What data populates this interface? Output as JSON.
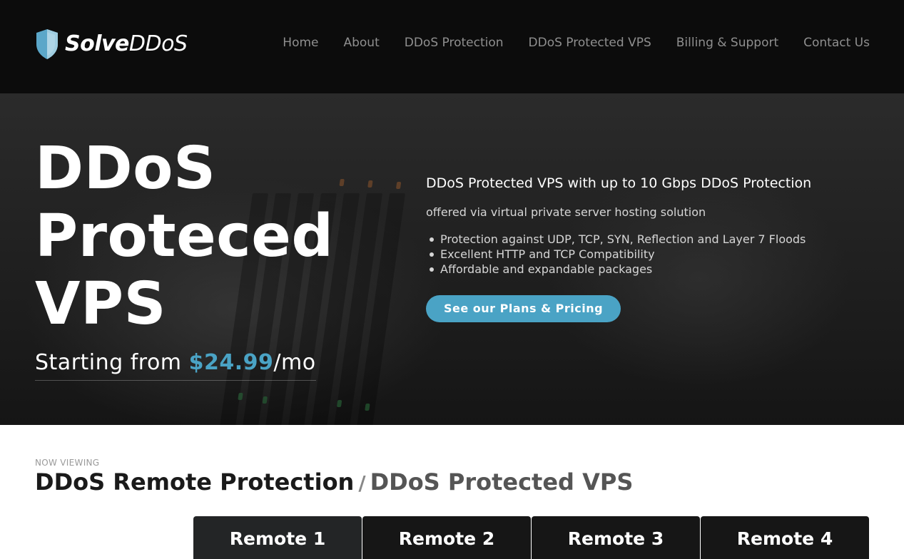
{
  "brand": {
    "name_bold": "Solve",
    "name_light": "DDoS",
    "icon": "shield-icon",
    "shield_colors": [
      "#5ba7c9",
      "#9fcde0"
    ]
  },
  "nav": {
    "items": [
      {
        "label": "Home"
      },
      {
        "label": "About"
      },
      {
        "label": "DDoS Protection"
      },
      {
        "label": "DDoS Protected VPS"
      },
      {
        "label": "Billing & Support"
      },
      {
        "label": "Contact Us"
      }
    ]
  },
  "hero": {
    "title_line1": "DDoS",
    "title_line2": "Proteced",
    "title_line3": "VPS",
    "price_prefix": "Starting from ",
    "price_amount": "$24.99",
    "price_suffix": "/mo",
    "subtitle": "DDoS Protected VPS with up to 10 Gbps DDoS Protection",
    "description": "offered via virtual private server hosting solution",
    "features": [
      "Protection against UDP, TCP, SYN, Reflection and Layer 7 Floods",
      "Excellent HTTP and TCP Compatibility",
      "Affordable and expandable packages"
    ],
    "cta_label": "See our Plans & Pricing",
    "accent_color": "#4aa3c5"
  },
  "content": {
    "now_viewing_label": "NOW VIEWING",
    "title_main": "DDoS Remote Protection",
    "title_separator": "/",
    "title_sub": "DDoS Protected VPS"
  },
  "plans": [
    {
      "label": "Remote 1"
    },
    {
      "label": "Remote 2"
    },
    {
      "label": "Remote 3"
    },
    {
      "label": "Remote 4"
    }
  ]
}
